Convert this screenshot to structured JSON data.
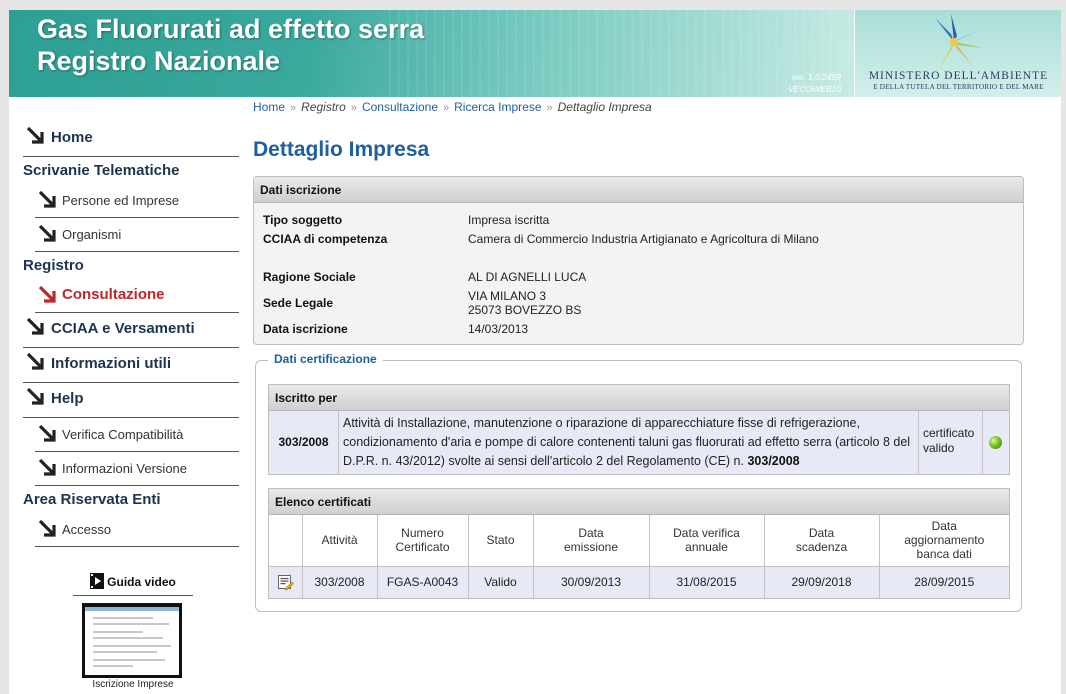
{
  "header": {
    "title_line1": "Gas Fluorurati ad effetto serra",
    "title_line2": "Registro Nazionale",
    "version": "ver. 1.0.2459",
    "server": "VECOWEB10",
    "ministry_line1": "MINISTERO DELL'AMBIENTE",
    "ministry_line2": "E DELLA TUTELA DEL TERRITORIO E DEL MARE"
  },
  "breadcrumb": {
    "home": "Home",
    "registro": "Registro",
    "consultazione": "Consultazione",
    "ricerca": "Ricerca Imprese",
    "current": "Dettaglio Impresa"
  },
  "sidebar": {
    "home": "Home",
    "scrivanie_heading": "Scrivanie Telematiche",
    "persone": "Persone ed Imprese",
    "organismi": "Organismi",
    "registro_heading": "Registro",
    "consultazione": "Consultazione",
    "cciaa": "CCIAA e Versamenti",
    "info_utili": "Informazioni utili",
    "help": "Help",
    "verifica": "Verifica Compatibilità",
    "versione": "Informazioni Versione",
    "area_heading": "Area Riservata Enti",
    "accesso": "Accesso"
  },
  "video": {
    "title": "Guida video",
    "caption": "Iscrizione Imprese"
  },
  "page_title": "Dettaglio Impresa",
  "dati_iscrizione": {
    "heading": "Dati iscrizione",
    "tipo_soggetto_label": "Tipo soggetto",
    "tipo_soggetto": "Impresa iscritta",
    "cciaa_label": "CCIAA di competenza",
    "cciaa": "Camera di Commercio Industria Artigianato e Agricoltura di Milano",
    "ragione_label": "Ragione Sociale",
    "ragione": "AL DI AGNELLI LUCA",
    "sede_label": "Sede Legale",
    "sede_line1": "VIA MILANO 3",
    "sede_line2": "25073 BOVEZZO BS",
    "data_label": "Data iscrizione",
    "data": "14/03/2013"
  },
  "dati_certificazione": {
    "legend": "Dati certificazione",
    "iscritto_heading": "Iscritto per",
    "iscritto": {
      "numero": "303/2008",
      "descrizione": "Attività di Installazione, manutenzione o riparazione di apparecchiature fisse di refrigerazione, condizionamento d'aria e pompe di calore contenenti taluni gas fluorurati ad effetto serra (articolo 8 del D.P.R. n. 43/2012) svolte ai sensi dell'articolo 2 del Regolamento (CE) n.",
      "regolamento": "303/2008",
      "stato_line1": "certificato",
      "stato_line2": "valido",
      "status_color": "#6db52a"
    },
    "elenco_heading": "Elenco certificati",
    "columns": {
      "attivita": "Attività",
      "numero_1": "Numero",
      "numero_2": "Certificato",
      "stato": "Stato",
      "emissione_1": "Data",
      "emissione_2": "emissione",
      "verifica_1": "Data verifica",
      "verifica_2": "annuale",
      "scadenza_1": "Data",
      "scadenza_2": "scadenza",
      "aggiornamento_1": "Data",
      "aggiornamento_2": "aggiornamento",
      "aggiornamento_3": "banca dati"
    },
    "certificati": [
      {
        "icon": "document-edit-icon",
        "attivita": "303/2008",
        "numero": "FGAS-A0043",
        "stato": "Valido",
        "emissione": "30/09/2013",
        "verifica": "31/08/2015",
        "scadenza": "29/09/2018",
        "aggiornamento": "28/09/2015"
      }
    ]
  },
  "colors": {
    "accent_blue": "#1f5fa0",
    "active_red": "#c0262b",
    "row_tint": "#e7e9f7",
    "banner_teal": "#2e9f94"
  }
}
